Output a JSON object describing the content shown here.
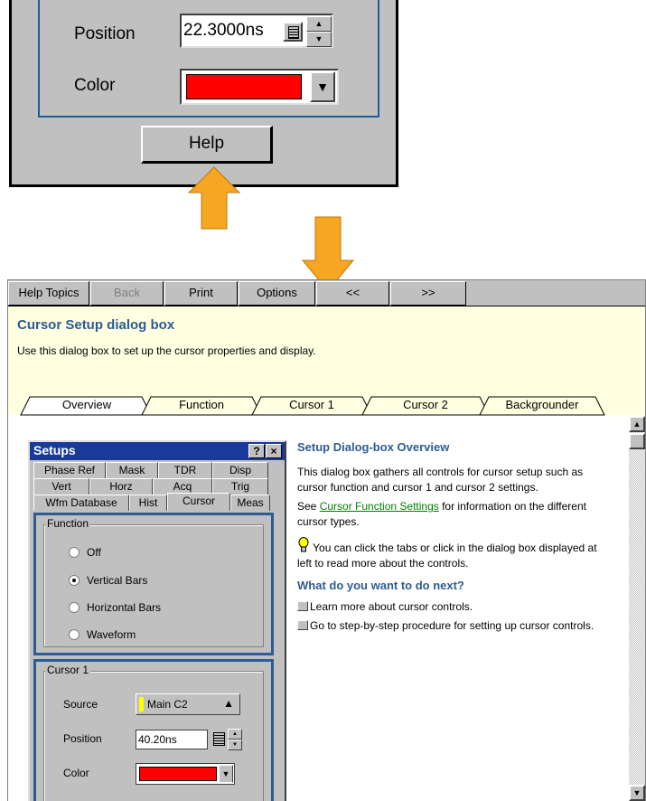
{
  "top_dialog": {
    "position_label": "Position",
    "position_value": "22.3000ns",
    "color_label": "Color",
    "color_value": "#ff0000",
    "help_button": "Help"
  },
  "arrow_color": "#f5a623",
  "help_window": {
    "toolbar": {
      "help_topics": "Help Topics",
      "back": "Back",
      "print": "Print",
      "options": "Options",
      "prev": "<<",
      "next": ">>"
    },
    "title": "Cursor Setup dialog box",
    "intro": "Use this dialog box to set up the cursor properties and display.",
    "tabs": [
      "Overview",
      "Function",
      "Cursor 1",
      "Cursor 2",
      "Backgrounder"
    ],
    "active_tab": "Overview",
    "setups": {
      "title": "Setups",
      "help_btn": "?",
      "close_btn": "×",
      "tab_rows": [
        [
          "Phase Ref",
          "Mask",
          "TDR",
          "Disp"
        ],
        [
          "Vert",
          "Horz",
          "Acq",
          "Trig"
        ],
        [
          "Wfm Database",
          "Hist",
          "Cursor",
          "Meas"
        ]
      ],
      "active_tab": "Cursor",
      "function_group": {
        "label": "Function",
        "options": [
          "Off",
          "Vertical Bars",
          "Horizontal Bars",
          "Waveform"
        ],
        "selected": "Vertical Bars"
      },
      "cursor1_group": {
        "label": "Cursor 1",
        "source_label": "Source",
        "source_value": "Main C2",
        "source_color": "#ffff00",
        "position_label": "Position",
        "position_value": "40.20ns",
        "color_label": "Color",
        "color_value": "#ff0000"
      }
    },
    "article": {
      "heading": "Setup Dialog-box Overview",
      "para1": "This dialog box gathers all controls for cursor setup such as cursor function and cursor 1 and cursor 2 settings.",
      "see_prefix": "See ",
      "see_link": "Cursor Function Settings",
      "see_suffix": " for information on the different cursor types.",
      "tip": "You can click the tabs or click in the dialog box displayed at left to read more about the controls.",
      "next_heading": "What do you want to do next?",
      "link1": "Learn more about cursor controls.",
      "link2": "Go to step-by-step procedure for setting up cursor controls."
    }
  }
}
